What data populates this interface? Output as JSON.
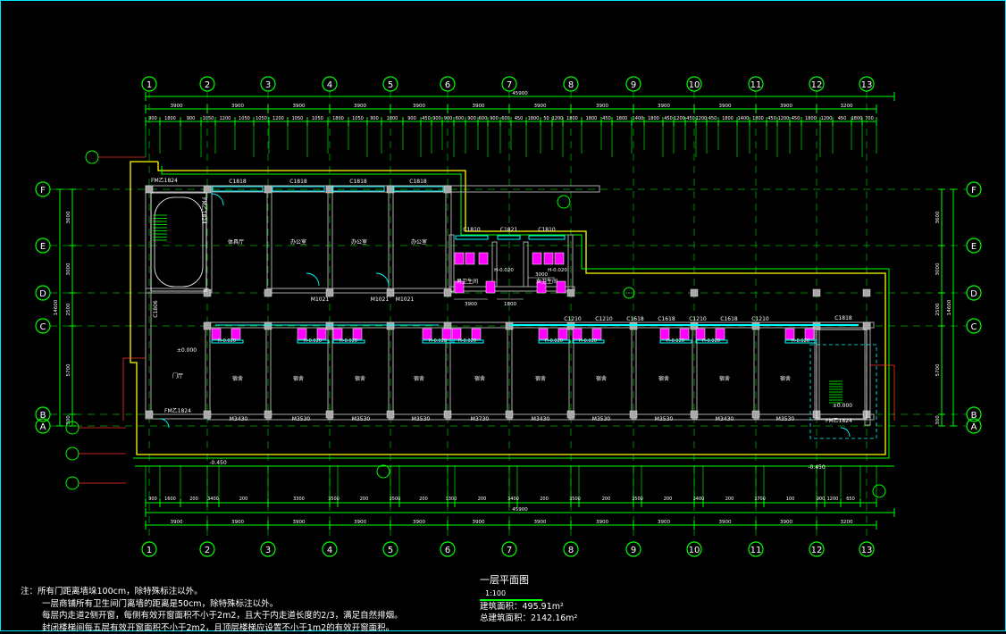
{
  "axes_h": [
    "1",
    "2",
    "3",
    "4",
    "5",
    "6",
    "7",
    "8",
    "9",
    "10",
    "11",
    "12",
    "13"
  ],
  "axes_v": [
    "F",
    "E",
    "D",
    "C",
    "B",
    "A"
  ],
  "dims": {
    "top_total": "45900",
    "bottom_total": "45900",
    "top_bays": [
      "3900",
      "3900",
      "3900",
      "3900",
      "3900",
      "3900",
      "3900",
      "3900",
      "3900",
      "3900",
      "3900",
      "3200"
    ],
    "bottom_bays": [
      "3900",
      "3900",
      "3900",
      "3900",
      "3900",
      "3900",
      "3900",
      "3900",
      "3900",
      "3900",
      "3900",
      "3200"
    ],
    "top_detail": [
      "900",
      "1800",
      "900",
      "1050",
      "1200",
      "1050",
      "1050",
      "1200",
      "1050",
      "1050",
      "1800",
      "1050",
      "900",
      "1800",
      "900",
      "450",
      "900",
      "450",
      "900",
      "900",
      "600",
      "900",
      "600",
      "450",
      "1800",
      "50",
      "1200",
      "1250",
      "1200",
      "450",
      "1800",
      "1800",
      "450",
      "1200",
      "450",
      "1200",
      "450",
      "1800",
      "1400",
      "1800",
      "450",
      "1200",
      "450",
      "1800",
      "1400",
      "1800",
      "450",
      "1200",
      "450",
      "1200",
      "450",
      "1800",
      "1400",
      "1800",
      "450",
      "1200",
      "450",
      "700",
      "1200",
      "450",
      "1800",
      "700"
    ],
    "bottom_detail": [
      "900",
      "1800",
      "1000",
      "3400",
      "3500",
      "3500",
      "3500",
      "3300",
      "3700",
      "3400",
      "3500",
      "3400",
      "3700",
      "900",
      "1200",
      "1900",
      "850"
    ],
    "bottom_detail_labels": [
      "900",
      "1600",
      "200",
      "3400",
      "200",
      "3500",
      "200",
      "3500",
      "200",
      "3300",
      "200",
      "3700",
      "200",
      "3400",
      "200",
      "3500",
      "200",
      "3400",
      "200",
      "3700",
      "100",
      "900",
      "1200",
      "650"
    ],
    "left_detail": [
      "3600",
      "3000",
      "2500",
      "5700",
      "300"
    ],
    "left_total": "14600",
    "right_detail": [
      "3600",
      "3000",
      "2500",
      "5700",
      "300"
    ],
    "right_total": "14600"
  },
  "rooms": {
    "stair_left": "楼梯",
    "room_1": "体具厅",
    "room_2": "办公室",
    "room_3": "办公室",
    "room_4": "办公室",
    "toilet_m": "男卫生间",
    "toilet_f": "女卫生间",
    "lobby": "门厅",
    "dorm": "宿舍",
    "elev_label": "±0.000",
    "elev_ext_left": "-0.450",
    "elev_ext_right": "-0.450",
    "elev_toilet_m": "H-0.020",
    "elev_toilet_f": "H-0.020"
  },
  "doors": {
    "fm_top": "FM乙1824",
    "fm_side": "FM乙1824",
    "fm_bottom": "FM乙1824",
    "fm_right": "FM乙1824",
    "m1021_a": "M1021",
    "m1021_b": "M1021",
    "m1021_c": "M1021",
    "m3430": "M3430",
    "m3530_a": "M3530",
    "m3530_b": "M3530",
    "m3530_c": "M3530",
    "m3730": "M3730",
    "m3430_b": "M3430",
    "m3530_d": "M3530",
    "m3530_e": "M3530",
    "m3430_c": "M3430",
    "m3530_f": "M3530"
  },
  "windows": {
    "top": [
      "C1818",
      "C1818",
      "C1818",
      "C1818"
    ],
    "toilet_top": [
      "C1810",
      "C1821",
      "C1810"
    ],
    "corridor": [
      "C1210",
      "C1210",
      "C1618",
      "C1618",
      "C1210",
      "C1618",
      "C1210"
    ],
    "c1818_right": "C1818",
    "c1806_left": "C1806",
    "c0621": "C0621"
  },
  "notes": {
    "line1": "注：所有门距离墙垛100cm，除特殊标注以外。",
    "line2": "一层商铺所有卫生间门离墙的距离是50cm，除特殊标注以外。",
    "line3": "每层内走道2侧开窗，每侧有效开窗面积不小于2m2，且大于内走道长度的2/3，满足自然排烟。",
    "line4": "封闭楼梯间每五层有效开窗面积不小于2m2，且顶层楼梯应设置不小于1m2的有效开窗面积。"
  },
  "title": {
    "name": "一层平面图",
    "scale": "1:100",
    "building_area_label": "建筑面积：",
    "building_area": "495.91m²",
    "total_area_label": "总建筑面积：",
    "total_area": "2142.16m²"
  }
}
